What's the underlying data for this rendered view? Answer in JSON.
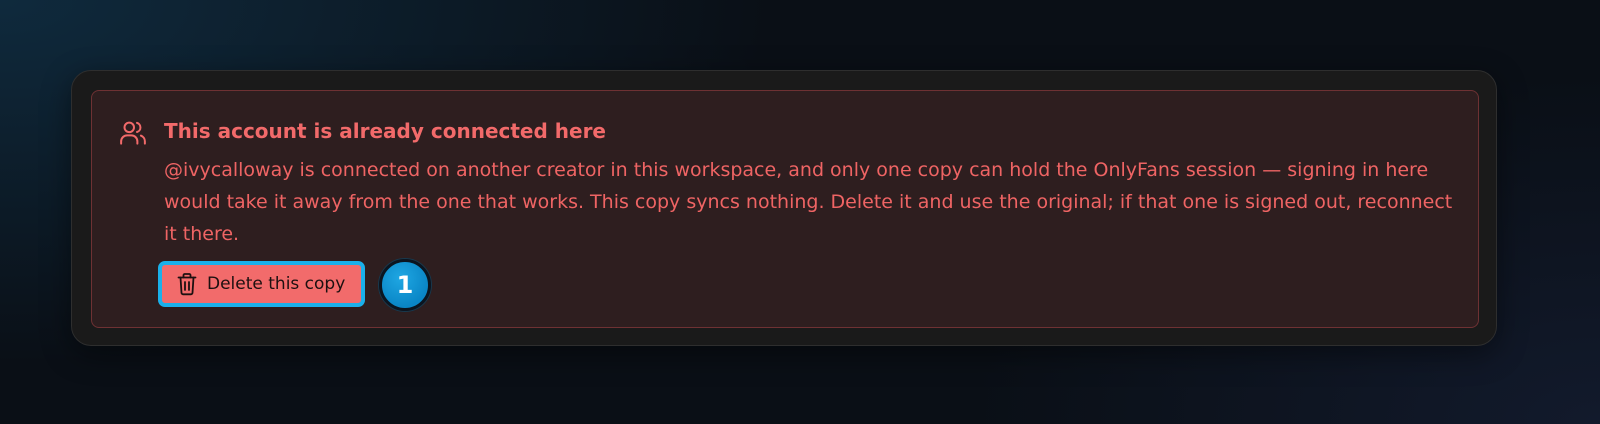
{
  "alert": {
    "icon": "users-icon",
    "title": "This account is already connected here",
    "body": "@ivycalloway is connected on another creator in this workspace, and only one copy can hold the OnlyFans session — signing in here would take it away from the one that works. This copy syncs nothing. Delete it and use the original; if that one is signed out, reconnect it there.",
    "delete_button": {
      "icon": "trash-icon",
      "label": "Delete this copy"
    }
  },
  "step_marker": {
    "number": "1"
  },
  "colors": {
    "alert_text": "#f26a6a",
    "alert_background": "#2e1e1f",
    "alert_border": "#6e3133",
    "button_background": "#f26b6b",
    "highlight": "#1ab0ea",
    "marker": "#0a86c6"
  }
}
